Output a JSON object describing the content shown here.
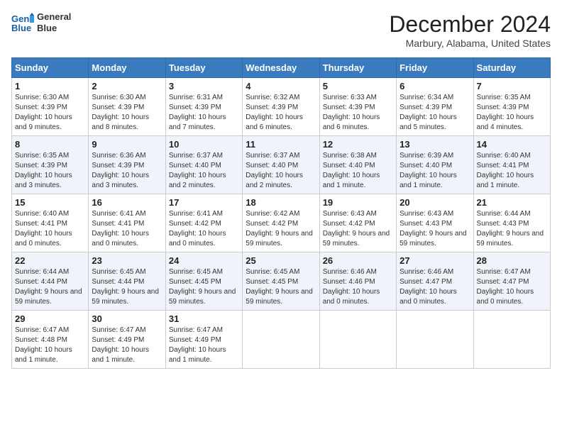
{
  "header": {
    "logo_line1": "General",
    "logo_line2": "Blue",
    "month": "December 2024",
    "location": "Marbury, Alabama, United States"
  },
  "days_of_week": [
    "Sunday",
    "Monday",
    "Tuesday",
    "Wednesday",
    "Thursday",
    "Friday",
    "Saturday"
  ],
  "weeks": [
    [
      {
        "day": "1",
        "sunrise": "6:30 AM",
        "sunset": "4:39 PM",
        "daylight": "10 hours and 9 minutes."
      },
      {
        "day": "2",
        "sunrise": "6:30 AM",
        "sunset": "4:39 PM",
        "daylight": "10 hours and 8 minutes."
      },
      {
        "day": "3",
        "sunrise": "6:31 AM",
        "sunset": "4:39 PM",
        "daylight": "10 hours and 7 minutes."
      },
      {
        "day": "4",
        "sunrise": "6:32 AM",
        "sunset": "4:39 PM",
        "daylight": "10 hours and 6 minutes."
      },
      {
        "day": "5",
        "sunrise": "6:33 AM",
        "sunset": "4:39 PM",
        "daylight": "10 hours and 6 minutes."
      },
      {
        "day": "6",
        "sunrise": "6:34 AM",
        "sunset": "4:39 PM",
        "daylight": "10 hours and 5 minutes."
      },
      {
        "day": "7",
        "sunrise": "6:35 AM",
        "sunset": "4:39 PM",
        "daylight": "10 hours and 4 minutes."
      }
    ],
    [
      {
        "day": "8",
        "sunrise": "6:35 AM",
        "sunset": "4:39 PM",
        "daylight": "10 hours and 3 minutes."
      },
      {
        "day": "9",
        "sunrise": "6:36 AM",
        "sunset": "4:39 PM",
        "daylight": "10 hours and 3 minutes."
      },
      {
        "day": "10",
        "sunrise": "6:37 AM",
        "sunset": "4:40 PM",
        "daylight": "10 hours and 2 minutes."
      },
      {
        "day": "11",
        "sunrise": "6:37 AM",
        "sunset": "4:40 PM",
        "daylight": "10 hours and 2 minutes."
      },
      {
        "day": "12",
        "sunrise": "6:38 AM",
        "sunset": "4:40 PM",
        "daylight": "10 hours and 1 minute."
      },
      {
        "day": "13",
        "sunrise": "6:39 AM",
        "sunset": "4:40 PM",
        "daylight": "10 hours and 1 minute."
      },
      {
        "day": "14",
        "sunrise": "6:40 AM",
        "sunset": "4:41 PM",
        "daylight": "10 hours and 1 minute."
      }
    ],
    [
      {
        "day": "15",
        "sunrise": "6:40 AM",
        "sunset": "4:41 PM",
        "daylight": "10 hours and 0 minutes."
      },
      {
        "day": "16",
        "sunrise": "6:41 AM",
        "sunset": "4:41 PM",
        "daylight": "10 hours and 0 minutes."
      },
      {
        "day": "17",
        "sunrise": "6:41 AM",
        "sunset": "4:42 PM",
        "daylight": "10 hours and 0 minutes."
      },
      {
        "day": "18",
        "sunrise": "6:42 AM",
        "sunset": "4:42 PM",
        "daylight": "9 hours and 59 minutes."
      },
      {
        "day": "19",
        "sunrise": "6:43 AM",
        "sunset": "4:42 PM",
        "daylight": "9 hours and 59 minutes."
      },
      {
        "day": "20",
        "sunrise": "6:43 AM",
        "sunset": "4:43 PM",
        "daylight": "9 hours and 59 minutes."
      },
      {
        "day": "21",
        "sunrise": "6:44 AM",
        "sunset": "4:43 PM",
        "daylight": "9 hours and 59 minutes."
      }
    ],
    [
      {
        "day": "22",
        "sunrise": "6:44 AM",
        "sunset": "4:44 PM",
        "daylight": "9 hours and 59 minutes."
      },
      {
        "day": "23",
        "sunrise": "6:45 AM",
        "sunset": "4:44 PM",
        "daylight": "9 hours and 59 minutes."
      },
      {
        "day": "24",
        "sunrise": "6:45 AM",
        "sunset": "4:45 PM",
        "daylight": "9 hours and 59 minutes."
      },
      {
        "day": "25",
        "sunrise": "6:45 AM",
        "sunset": "4:45 PM",
        "daylight": "9 hours and 59 minutes."
      },
      {
        "day": "26",
        "sunrise": "6:46 AM",
        "sunset": "4:46 PM",
        "daylight": "10 hours and 0 minutes."
      },
      {
        "day": "27",
        "sunrise": "6:46 AM",
        "sunset": "4:47 PM",
        "daylight": "10 hours and 0 minutes."
      },
      {
        "day": "28",
        "sunrise": "6:47 AM",
        "sunset": "4:47 PM",
        "daylight": "10 hours and 0 minutes."
      }
    ],
    [
      {
        "day": "29",
        "sunrise": "6:47 AM",
        "sunset": "4:48 PM",
        "daylight": "10 hours and 1 minute."
      },
      {
        "day": "30",
        "sunrise": "6:47 AM",
        "sunset": "4:49 PM",
        "daylight": "10 hours and 1 minute."
      },
      {
        "day": "31",
        "sunrise": "6:47 AM",
        "sunset": "4:49 PM",
        "daylight": "10 hours and 1 minute."
      },
      null,
      null,
      null,
      null
    ]
  ],
  "labels": {
    "sunrise": "Sunrise:",
    "sunset": "Sunset:",
    "daylight": "Daylight:"
  }
}
